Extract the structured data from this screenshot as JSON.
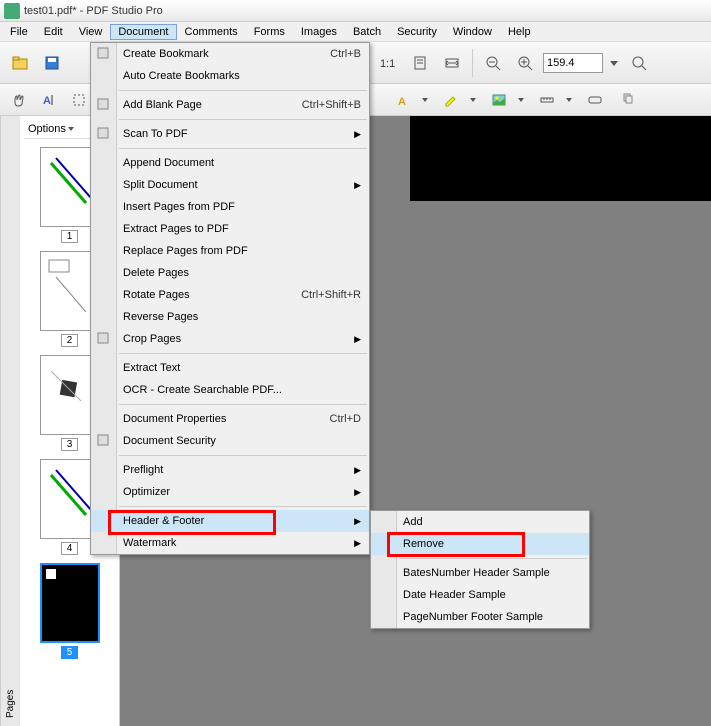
{
  "window": {
    "title": "test01.pdf* - PDF Studio Pro"
  },
  "menubar": {
    "items": [
      "File",
      "Edit",
      "View",
      "Document",
      "Comments",
      "Forms",
      "Images",
      "Batch",
      "Security",
      "Window",
      "Help"
    ],
    "active_index": 3
  },
  "toolbar": {
    "zoom_value": "159.4"
  },
  "sidebar": {
    "tab_label": "Pages",
    "options_label": "Options",
    "thumbs": [
      {
        "num": "1",
        "selected": false
      },
      {
        "num": "2",
        "selected": false
      },
      {
        "num": "3",
        "selected": false
      },
      {
        "num": "4",
        "selected": false
      },
      {
        "num": "5",
        "selected": true
      }
    ]
  },
  "document_menu": {
    "groups": [
      [
        {
          "label": "Create Bookmark",
          "shortcut": "Ctrl+B",
          "icon": "bookmark"
        },
        {
          "label": "Auto Create Bookmarks",
          "shortcut": "",
          "icon": ""
        }
      ],
      [
        {
          "label": "Add Blank Page",
          "shortcut": "Ctrl+Shift+B",
          "icon": "blank-page"
        }
      ],
      [
        {
          "label": "Scan To PDF",
          "shortcut": "",
          "icon": "scanner",
          "submenu": true
        }
      ],
      [
        {
          "label": "Append Document",
          "shortcut": "",
          "icon": ""
        },
        {
          "label": "Split Document",
          "shortcut": "",
          "icon": "",
          "submenu": true
        },
        {
          "label": "Insert Pages from PDF",
          "shortcut": "",
          "icon": ""
        },
        {
          "label": "Extract Pages to PDF",
          "shortcut": "",
          "icon": ""
        },
        {
          "label": "Replace Pages from PDF",
          "shortcut": "",
          "icon": ""
        },
        {
          "label": "Delete Pages",
          "shortcut": "",
          "icon": ""
        },
        {
          "label": "Rotate Pages",
          "shortcut": "Ctrl+Shift+R",
          "icon": ""
        },
        {
          "label": "Reverse Pages",
          "shortcut": "",
          "icon": ""
        },
        {
          "label": "Crop Pages",
          "shortcut": "",
          "icon": "crop",
          "submenu": true
        }
      ],
      [
        {
          "label": "Extract Text",
          "shortcut": "",
          "icon": ""
        },
        {
          "label": "OCR - Create Searchable PDF...",
          "shortcut": "",
          "icon": ""
        }
      ],
      [
        {
          "label": "Document Properties",
          "shortcut": "Ctrl+D",
          "icon": ""
        },
        {
          "label": "Document Security",
          "shortcut": "",
          "icon": "security"
        }
      ],
      [
        {
          "label": "Preflight",
          "shortcut": "",
          "icon": "",
          "submenu": true
        },
        {
          "label": "Optimizer",
          "shortcut": "",
          "icon": "",
          "submenu": true
        }
      ],
      [
        {
          "label": "Header & Footer",
          "shortcut": "",
          "icon": "",
          "submenu": true,
          "hover": true,
          "redbox": true
        },
        {
          "label": "Watermark",
          "shortcut": "",
          "icon": "",
          "submenu": true
        }
      ]
    ]
  },
  "submenu": {
    "groups": [
      [
        {
          "label": "Add"
        },
        {
          "label": "Remove",
          "hover": true,
          "redbox": true
        }
      ],
      [
        {
          "label": "BatesNumber Header Sample"
        },
        {
          "label": "Date Header Sample"
        },
        {
          "label": "PageNumber Footer Sample"
        }
      ]
    ]
  }
}
